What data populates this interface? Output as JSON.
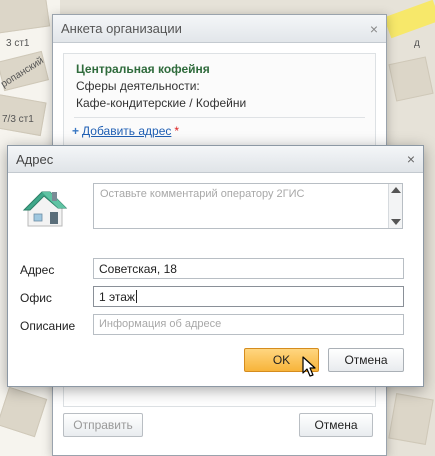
{
  "map": {
    "labels": [
      "3 ст1",
      "ропанский",
      "7/3 ст1",
      "д"
    ]
  },
  "back_window": {
    "title": "Анкета организации",
    "org_name": "Центральная кофейня",
    "sphere_label": "Сферы деятельности:",
    "sphere_value": "Кафе-кондитерские / Кофейни",
    "add_address_plus": "+",
    "add_address_link": "Добавить адрес",
    "required_star": "*",
    "send_button": "Отправить",
    "cancel_button": "Отмена"
  },
  "dialog": {
    "title": "Адрес",
    "close": "×",
    "icon": "house-icon",
    "comment": {
      "placeholder": "Оставьте комментарий оператору 2ГИС"
    },
    "fields": {
      "address": {
        "label": "Адрес",
        "value": "Советская, 18"
      },
      "office": {
        "label": "Офис",
        "value": "1 этаж"
      },
      "description": {
        "label": "Описание",
        "value": "",
        "placeholder": "Информация об адресе"
      }
    },
    "ok_button": "OK",
    "cancel_button": "Отмена"
  },
  "colors": {
    "org_name": "#2f6b3c",
    "link": "#1f5fb4",
    "ok_button": "#f7b43a",
    "map_highlight": "#f7e86a"
  }
}
